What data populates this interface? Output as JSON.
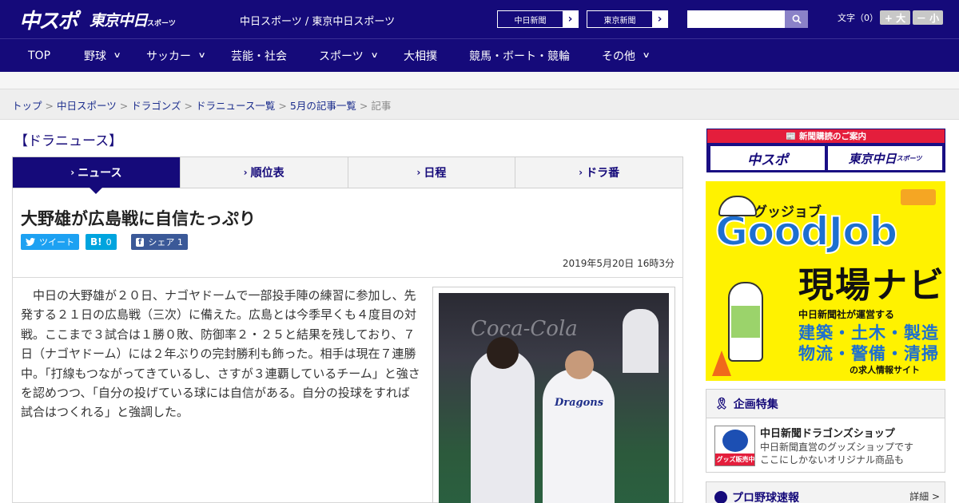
{
  "header": {
    "logo_chuspo": "中スポ",
    "logo_tokyo": "東京中日",
    "logo_tokyo_sub": "スポーツ",
    "site_title": "中日スポーツ / 東京中日スポーツ",
    "link_chunichi": "中日新聞",
    "link_tokyo": "東京新聞",
    "search_placeholder": "",
    "font_label": "文字（0）",
    "font_larger": "+ 大",
    "font_smaller": "－ 小"
  },
  "nav": {
    "items": [
      {
        "label": "TOP",
        "dropdown": false
      },
      {
        "label": "野球",
        "dropdown": true
      },
      {
        "label": "サッカー",
        "dropdown": true
      },
      {
        "label": "芸能・社会",
        "dropdown": false
      },
      {
        "label": "スポーツ",
        "dropdown": true
      },
      {
        "label": "大相撲",
        "dropdown": false
      },
      {
        "label": "競馬・ボート・競輪",
        "dropdown": false
      },
      {
        "label": "その他",
        "dropdown": true
      }
    ]
  },
  "breadcrumb": [
    "トップ",
    "中日スポーツ",
    "ドラゴンズ",
    "ドラニュース一覧",
    "5月の記事一覧",
    "記事"
  ],
  "section": {
    "heading": "【ドラニュース】",
    "tabs": [
      {
        "label": "ニュース",
        "active": true
      },
      {
        "label": "順位表",
        "active": false
      },
      {
        "label": "日程",
        "active": false
      },
      {
        "label": "ドラ番",
        "active": false
      }
    ]
  },
  "article": {
    "title": "大野雄が広島戦に自信たっぷり",
    "share_tweet": "ツイート",
    "share_hatena_count": "0",
    "share_fb": "シェア 1",
    "date": "2019年5月20日 16時3分",
    "body": "中日の大野雄が２０日、ナゴヤドームで一部投手陣の練習に参加し、先発する２１日の広島戦（三次）に備えた。広島とは今季早くも４度目の対戦。ここまで３試合は１勝０敗、防御率２・２５と結果を残しており、７日（ナゴヤドーム）には２年ぶりの完封勝利も飾った。相手は現在７連勝中。「打線もつながってきているし、さすが３連覇しているチーム」と強さを認めつつ、「自分の投げている球には自信がある。自分の投球をすれば試合はつくれる」と強調した。",
    "photo_banner_text": "Coca-Cola",
    "photo_jersey_text": "Dragons"
  },
  "sidebar": {
    "subscribe_head": "新聞購読のご案内",
    "subscribe_chuspo": "中スポ",
    "subscribe_tokyo": "東京中日",
    "subscribe_tokyo_sub": "スポーツ",
    "ad_kicker": "グッジョブ",
    "ad_brand": "GoodJob",
    "ad_title": "現場ナビ",
    "ad_runby": "中日新聞社が運営する",
    "ad_jobs1": "建築・土木・製造",
    "ad_jobs2": "物流・警備・清掃",
    "ad_site": "の求人情報サイト",
    "feature_heading": "企画特集",
    "shop_thumb_label": "グッズ販売中",
    "shop_title": "中日新聞ドラゴンズショップ",
    "shop_desc1": "中日新聞直営のグッズショップです",
    "shop_desc2": "ここにしかないオリジナル商品も",
    "baseball_heading": "プロ野球速報",
    "baseball_more": "詳細 >"
  },
  "colors": {
    "brand_navy": "#150a7a",
    "accent_red": "#e41e3c",
    "twitter": "#1da1f2",
    "hatena": "#00a4de",
    "facebook": "#3b5998",
    "ad_yellow": "#fff200"
  }
}
